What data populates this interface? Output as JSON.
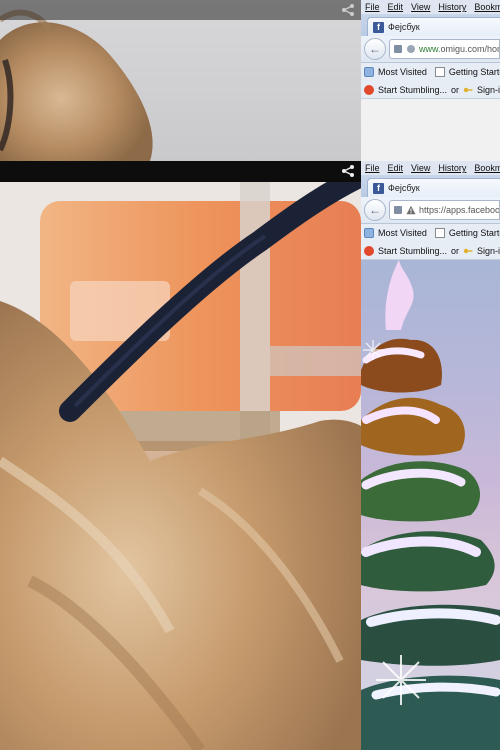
{
  "photos": {
    "top": {
      "share_icon": "share-icon"
    },
    "bottom": {
      "share_icon": "share-icon"
    }
  },
  "browser_top": {
    "menu": [
      "File",
      "Edit",
      "View",
      "History",
      "Bookmarks"
    ],
    "tab_title": "Фејсбук",
    "url_green": "www.",
    "url_rest": "omigu.com/home",
    "bookmarks": [
      "Most Visited",
      "Getting Started"
    ],
    "addon_stumble": "Start Stumbling...",
    "addon_or": "or",
    "addon_signin": "Sign-in"
  },
  "browser_bottom": {
    "menu": [
      "File",
      "Edit",
      "View",
      "History",
      "Bookmarks"
    ],
    "tab_title": "Фејсбук",
    "url_secure": "https://",
    "url_rest": "apps.facebook.com",
    "bookmarks": [
      "Most Visited",
      "Getting Started"
    ],
    "addon_stumble": "Start Stumbling...",
    "addon_or": "or",
    "addon_signin": "Sign-in"
  },
  "colors": {
    "facebook_blue": "#3b5998",
    "url_green": "#2f7d32",
    "leash": "#1c2235",
    "fur": "#c79a6c"
  }
}
